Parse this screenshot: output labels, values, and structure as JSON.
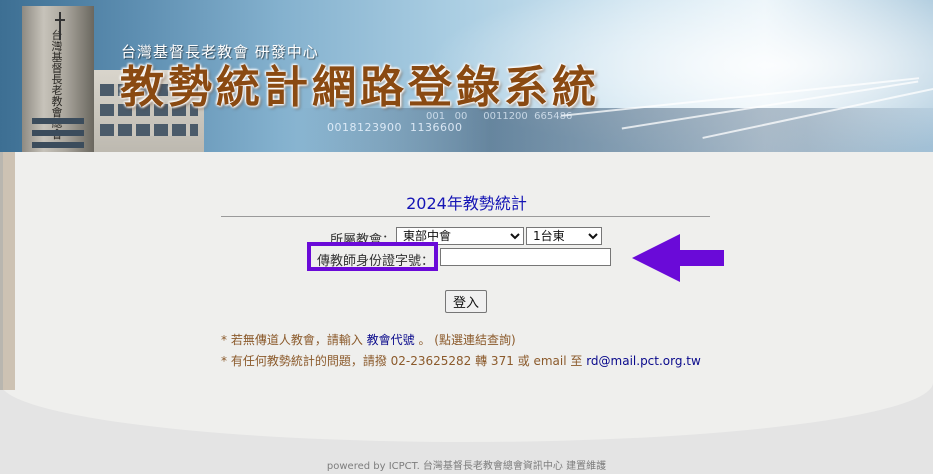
{
  "banner": {
    "org": "台灣基督長老教會  研發中心",
    "title": "教勢統計網路登錄系統",
    "digits": "0018123900  1136600",
    "digits2": "001   00     0011200  665486",
    "sign_text": "台灣基督長老教會總會"
  },
  "form": {
    "heading": "2024年教勢統計",
    "church_label": "所屬教會：",
    "region_selected": "東部中會",
    "church_selected": "1台東",
    "id_label": "傳教師身份證字號：",
    "id_value": "",
    "login_label": "登入"
  },
  "notes": {
    "line1_prefix": "* 若無傳道人教會，請輸入 ",
    "line1_link": "教會代號",
    "line1_suffix": " 。 (點選連結查詢)",
    "line2_prefix": "* 有任何教勢統計的問題，請撥 02-23625282 轉 371 或 email 至 ",
    "line2_email": "rd@mail.pct.org.tw"
  },
  "footer": {
    "text": "powered by ICPCT. 台灣基督長老教會總會資訊中心 建置維護"
  },
  "colors": {
    "highlight": "#6a0ad8",
    "heading": "#1515b5",
    "title": "#8a4a12"
  }
}
